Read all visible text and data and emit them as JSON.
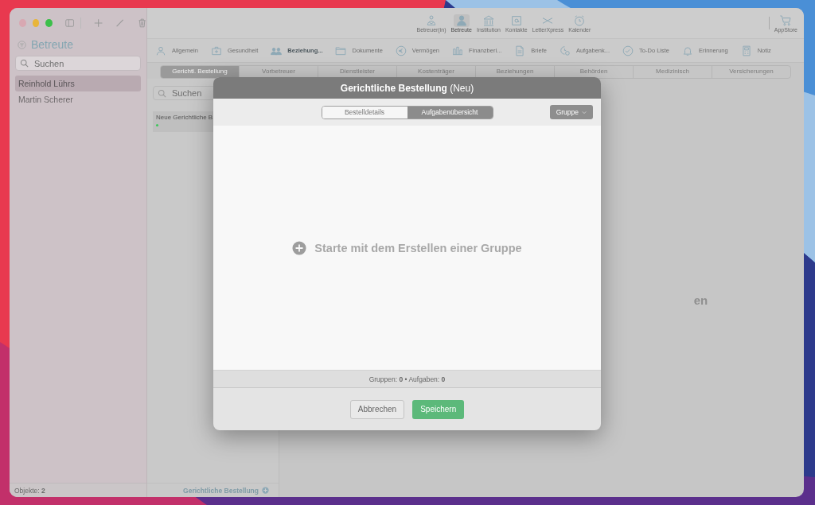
{
  "sidebar": {
    "title": "Betreute",
    "search": {
      "placeholder": "Suchen"
    },
    "items": [
      {
        "name": "Reinhold Lührs",
        "selected": true
      },
      {
        "name": "Martin Scherer",
        "selected": false
      }
    ],
    "status": "Objekte: **2**"
  },
  "top_nav": [
    {
      "label": "Betreuer(in)",
      "selected": false
    },
    {
      "label": "Betreute",
      "selected": true
    },
    {
      "label": "Institution",
      "selected": false
    },
    {
      "label": "Kontakte",
      "selected": false
    },
    {
      "label": "LetterXpress",
      "selected": false
    },
    {
      "label": "Kalender",
      "selected": false
    }
  ],
  "appstore": "AppStore",
  "section_tabs": [
    {
      "label": "Allgemein",
      "selected": false
    },
    {
      "label": "Gesundheit",
      "selected": false
    },
    {
      "label": "Beziehung...",
      "selected": true
    },
    {
      "label": "Dokumente",
      "selected": false
    },
    {
      "label": "Vermögen",
      "selected": false
    },
    {
      "label": "Finanzberi...",
      "selected": false
    },
    {
      "label": "Briefe",
      "selected": false
    },
    {
      "label": "Aufgabenk...",
      "selected": false
    },
    {
      "label": "To-Do Liste",
      "selected": false
    },
    {
      "label": "Erinnerung",
      "selected": false
    },
    {
      "label": "Notiz",
      "selected": false
    }
  ],
  "sub_tabs": [
    {
      "label": "Gerichtl. Bestellung",
      "selected": true
    },
    {
      "label": "Vorbetreuer",
      "selected": false
    },
    {
      "label": "Dienstleister",
      "selected": false
    },
    {
      "label": "Kostenträger",
      "selected": false
    },
    {
      "label": "Beziehungen",
      "selected": false
    },
    {
      "label": "Behörden",
      "selected": false
    },
    {
      "label": "Medizinisch",
      "selected": false
    },
    {
      "label": "Versicherungen",
      "selected": false
    }
  ],
  "list": {
    "search": {
      "placeholder": "Suchen"
    },
    "items": [
      {
        "title": "Neue Gerichtliche B",
        "color": "#3cc85a"
      }
    ],
    "footer": "Gerichtliche Bestellung"
  },
  "main_text": "en",
  "dialog": {
    "title": "**Gerichtliche Bestellung** (Neu)",
    "segments": [
      {
        "label": "Bestelldetails",
        "selected": false
      },
      {
        "label": "Aufgabenübersicht",
        "selected": true
      }
    ],
    "group_button": "Gruppe",
    "empty_text": "Starte mit dem Erstellen einer Gruppe",
    "stats": "Gruppen: **0** • Aufgaben: **0**",
    "cancel": "Abbrechen",
    "save": "Speichern"
  }
}
